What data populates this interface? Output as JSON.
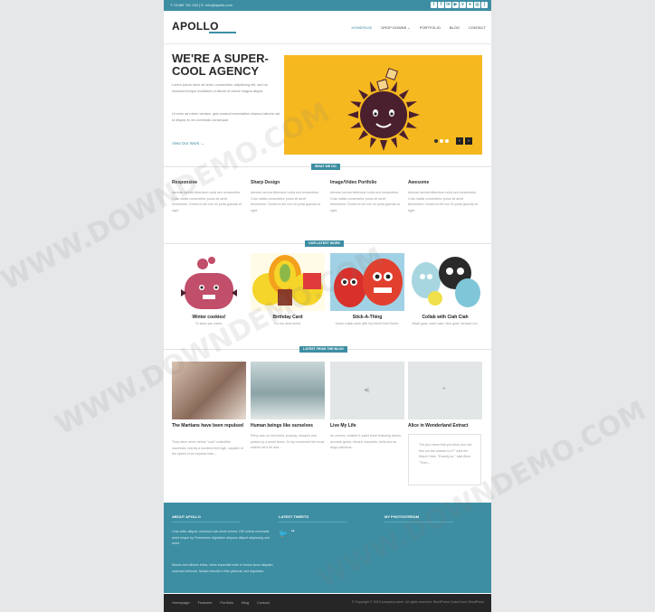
{
  "topbar": {
    "contact": "T: 01489 781 333  |  E: info@apollo.com",
    "social_icons": [
      "twitter-icon",
      "facebook-icon",
      "linkedin-icon",
      "youtube-icon",
      "vimeo-icon",
      "flickr-icon",
      "dribbble-icon",
      "rss-icon"
    ]
  },
  "header": {
    "logo": "APOLLO",
    "nav": [
      "HOMEPAGE",
      "DROP DOWNS",
      "PORTFOLIO",
      "BLOG",
      "CONTACT"
    ],
    "active_nav": "HOMEPAGE"
  },
  "hero": {
    "title": "WE'RE A SUPER-COOL AGENCY",
    "p1": "Lorem ipsum dolor sit amet, consectetur adipisicing elit, sed do eiusmod tempor incididunt ut labore et dolore magna aliqua.",
    "p2": "Ut enim ad minim veniam, quis nostrud exercitation ullamco laboris nisi ut aliquip ex ea commodo consequat.",
    "link": "View Our Work →",
    "slider_color": "#f5b81f"
  },
  "services": {
    "tag": "WHAT WE DO",
    "items": [
      {
        "title": "Responsive",
        "text": "Aenean lacinia bibendum nulla sed consectetur. Cras mattis consectetur purus sit amet fermentum. Donec id elit non mi porta gravida at eget."
      },
      {
        "title": "Sharp Design",
        "text": "Aenean lacinia bibendum nulla sed consectetur. Cras mattis consectetur purus sit amet fermentum. Donec id elit non mi porta gravida at eget."
      },
      {
        "title": "Image/Video Portfolio",
        "text": "Aenean lacinia bibendum nulla sed consectetur. Cras mattis consectetur purus sit amet fermentum. Donec id elit non mi porta gravida at eget."
      },
      {
        "title": "Awesome",
        "text": "Aenean lacinia bibendum nulla sed consectetur. Cras mattis consectetur purus sit amet fermentum. Donec id elit non mi porta gravida at eget."
      }
    ]
  },
  "portfolio": {
    "tag": "OUR LATEST WORK",
    "items": [
      {
        "title": "Winter cookies!",
        "sub": "To keep you warm."
      },
      {
        "title": "Birthday Card",
        "sub": "For my dear friend."
      },
      {
        "title": "Stick-A-Thing",
        "sub": "Some collab work with my friend from Berlin."
      },
      {
        "title": "Collab with Ciah Ciah",
        "sub": "Black goat, cash cash, blue goat, forward run."
      }
    ]
  },
  "blog": {
    "tag": "LATEST FROM THE BLOG",
    "items": [
      {
        "title": "The Martians have been repulsed",
        "text": "They were never before \"cool\" collectible machines, merely a hundred feet high, capable of the speed of an express train..."
      },
      {
        "title": "Human beings like ourselves",
        "text": "Perry was on his knees, praying, stooped and picked up a small stone. At my movement the brute whirled off a bit and..."
      },
      {
        "title": "Live My Life",
        "text": "An uneven, twisted & joyful track featuring drums, acoustic guitar, electric mandolin, bells and an angry fabulous..."
      },
      {
        "title": "Alice in Wonderland Extract",
        "text": "\"Do you mean that you think you can find out the answer to it?\" said the March Hare. \"Exactly so,\" said Alice. \"Then..."
      }
    ]
  },
  "footer": {
    "about_head": "ABOUT APOLLO",
    "about_p1": "Cras dolor aliquet, euismod odio amet viverra. Elit viverra venenatis amet neque by Fermentum dignissim aliquam aliquet adipiscing sed amet.",
    "about_p2": "Mauris sed ultrices tellus, tellus imperdiet enim in lectus lacus aliquam euismod vehicula. Nullam blandit in felis placerat, sed dignissim.",
    "tweets_head": "LATEST TWEETS",
    "photo_head": "MY PHOTOSTREAM",
    "nav": [
      "Homepage",
      "Features",
      "Portfolio",
      "Blog",
      "Contact"
    ],
    "copyright": "© Copyright © 2013 company name. All rights reserved. WordPress Coded from WordPress"
  },
  "watermark": "WWW.DOWNDEMO.COM",
  "colors": {
    "accent": "#3d8ea3",
    "dark": "#262626",
    "yellow": "#f5b81f"
  }
}
